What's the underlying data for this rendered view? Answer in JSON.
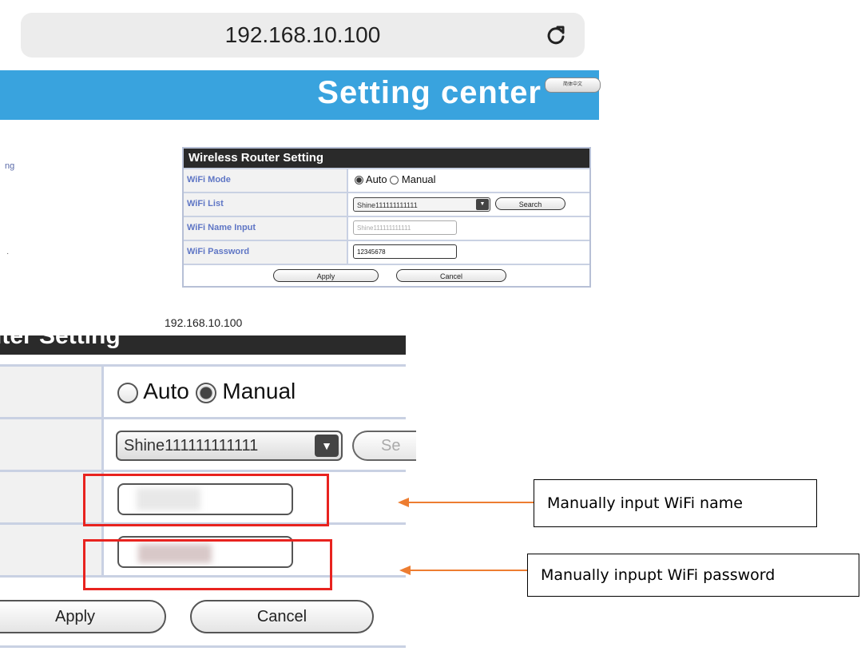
{
  "browser": {
    "url": "192.168.10.100"
  },
  "header": {
    "title": "Setting center",
    "language_button": "简体中文"
  },
  "left_fragments": [
    "ng",
    "·"
  ],
  "small_panel": {
    "title": "Wireless Router Setting",
    "rows": [
      {
        "label": "WiFi Mode"
      },
      {
        "label": "WiFi List"
      },
      {
        "label": "WiFi Name Input"
      },
      {
        "label": "WiFi Password"
      }
    ],
    "mode_auto": "Auto",
    "mode_manual": "Manual",
    "selected_mode": "Auto",
    "wifi_list_value": "Shine111111111111",
    "search_label": "Search",
    "name_input_placeholder": "Shine111111111111",
    "password_value": "12345678",
    "apply_label": "Apply",
    "cancel_label": "Cancel"
  },
  "zoomed": {
    "url": "192.168.10.100",
    "header_fragment": "iter Setting",
    "mode_auto": "Auto",
    "mode_manual": "Manual",
    "selected_mode": "Manual",
    "wifi_list_value": "Shine111111111111",
    "search_fragment": "Se",
    "apply_label": "Apply",
    "cancel_label": "Cancel"
  },
  "annotations": {
    "name_callout": "Manually input WiFi name",
    "password_callout": "Manually inpupt WiFi password",
    "highlight_color": "#e8231f",
    "arrow_color": "#ed7d31"
  }
}
